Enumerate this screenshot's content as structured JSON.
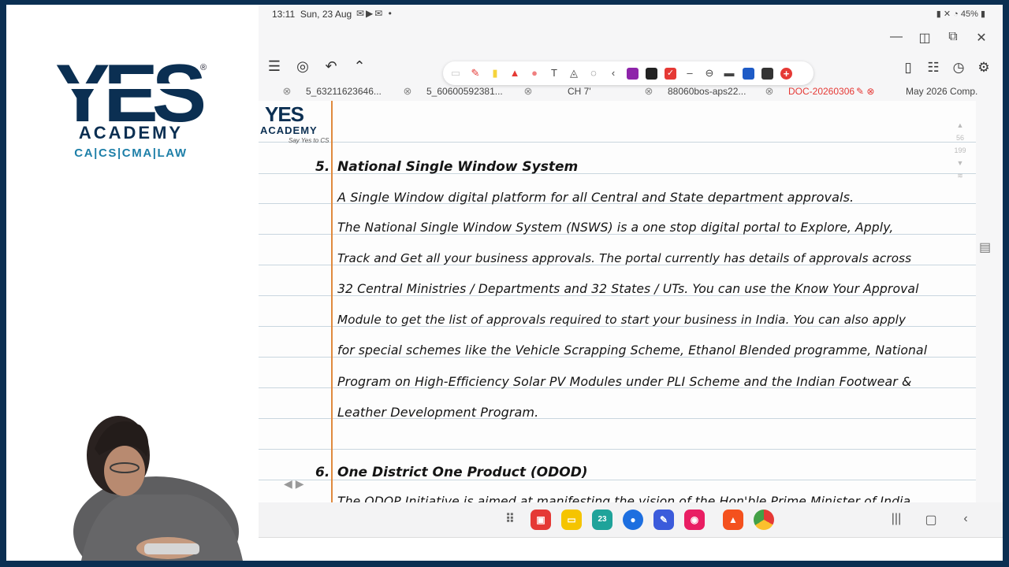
{
  "brand": {
    "logo_text": "YES",
    "registered": "®",
    "academy": "ACADEMY",
    "subtitle": "CA|CS|CMA|LAW"
  },
  "status_bar": {
    "time": "13:11",
    "date": "Sun, 23 Aug",
    "battery": "45%"
  },
  "toolbar": {
    "menu_icon": "menu-icon",
    "pen_colors": [
      "#8e24aa",
      "#222222",
      "#e53935",
      "#1e5bc6",
      "#333333"
    ]
  },
  "tabs": [
    {
      "label": "5_63211623646..."
    },
    {
      "label": "5_60600592381..."
    },
    {
      "label": "CH 7'"
    },
    {
      "label": "88060bos-aps22..."
    },
    {
      "label": "DOC-20260306-..."
    },
    {
      "label": "May 2026 Comp."
    }
  ],
  "page": {
    "logo_yes": "YES",
    "logo_academy": "ACADEMY",
    "logo_tagline": "Say Yes to CS",
    "scroll_top": "56",
    "scroll_total": "199",
    "section5": {
      "number": "5.",
      "heading": "National Single Window System",
      "lines": [
        "A Single Window digital platform for all Central and State department approvals.",
        "The National Single Window System (NSWS) is a one stop digital portal to Explore, Apply,",
        "Track and Get all your business approvals. The portal currently has details of approvals across",
        "32 Central Ministries / Departments and 32 States / UTs. You can use the Know Your Approval",
        "Module to get the list of approvals required to start your business in India. You can also apply",
        "for special schemes like the Vehicle Scrapping Scheme, Ethanol Blended programme, National",
        "Program on High-Efficiency Solar PV Modules under PLI Scheme and the Indian Footwear &",
        "Leather Development Program."
      ]
    },
    "section6": {
      "number": "6.",
      "heading": "One District One Product (ODOD)",
      "partial_line": "The ODOP Initiative is aimed at manifesting the vision of the Hon'ble Prime Minister of India"
    }
  }
}
